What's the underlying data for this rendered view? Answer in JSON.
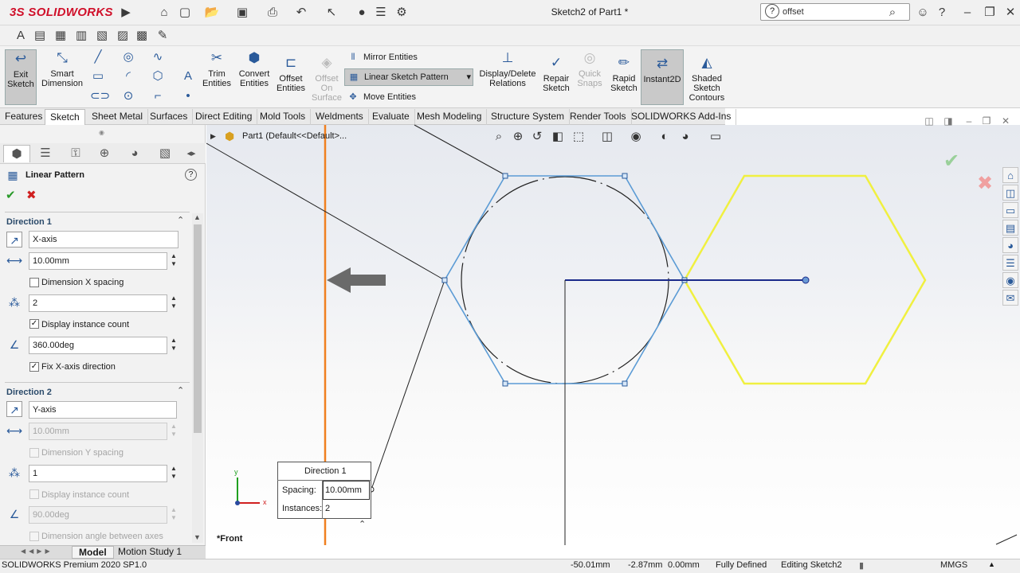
{
  "app": {
    "brand": "SOLIDWORKS",
    "doc_title": "Sketch2 of Part1 *"
  },
  "search": {
    "value": "offset"
  },
  "commands": {
    "exit_sketch": "Exit Sketch",
    "smart_dimension": "Smart Dimension",
    "trim_entities": "Trim Entities",
    "convert_entities": "Convert Entities",
    "offset_entities": "Offset Entities",
    "offset_on_surface": "Offset On Surface",
    "mirror_entities": "Mirror Entities",
    "linear_sketch_pattern": "Linear Sketch Pattern",
    "move_entities": "Move Entities",
    "display_delete_relations": "Display/Delete Relations",
    "repair_sketch": "Repair Sketch",
    "quick_snaps": "Quick Snaps",
    "rapid_sketch": "Rapid Sketch",
    "instant2d": "Instant2D",
    "shaded_sketch_contours": "Shaded Sketch Contours"
  },
  "tabs": [
    "Features",
    "Sketch",
    "Sheet Metal",
    "Surfaces",
    "Direct Editing",
    "Mold Tools",
    "Weldments",
    "Evaluate",
    "Mesh Modeling",
    "Structure System",
    "Render Tools",
    "SOLIDWORKS Add-Ins"
  ],
  "active_tab": "Sketch",
  "panel": {
    "title": "Linear Pattern",
    "direction1": {
      "title": "Direction 1",
      "axis": "X-axis",
      "spacing": "10.00mm",
      "dimension_spacing_label": "Dimension X spacing",
      "dimension_spacing_checked": false,
      "instances": "2",
      "display_count_label": "Display instance count",
      "display_count_checked": true,
      "angle": "360.00deg",
      "fix_axis_label": "Fix X-axis direction",
      "fix_axis_checked": true
    },
    "direction2": {
      "title": "Direction 2",
      "axis": "Y-axis",
      "spacing": "10.00mm",
      "dimension_spacing_label": "Dimension Y spacing",
      "instances": "1",
      "display_count_label": "Display instance count",
      "angle": "90.00deg",
      "dimension_angle_label": "Dimension angle between axes"
    }
  },
  "graphics": {
    "tree_crumb": "Part1  (Default<<Default>...",
    "view_label": "*Front",
    "triad_x": "x",
    "triad_y": "y",
    "callout": {
      "title": "Direction 1",
      "spacing_label": "Spacing:",
      "spacing_value": "10.00mm",
      "instances_label": "Instances:",
      "instances_value": "2"
    }
  },
  "bottom_tabs": [
    "Model",
    "Motion Study 1"
  ],
  "status": {
    "product": "SOLIDWORKS Premium 2020 SP1.0",
    "x": "-50.01mm",
    "y": "-2.87mm",
    "z": "0.00mm",
    "state": "Fully Defined",
    "editing": "Editing Sketch2",
    "units": "MMGS"
  },
  "colors": {
    "pattern_preview": "#f0f040",
    "sketch_blue": "#5b9bd5",
    "centerline_navy": "#1a2a8a",
    "orange_axis": "#f08020"
  }
}
